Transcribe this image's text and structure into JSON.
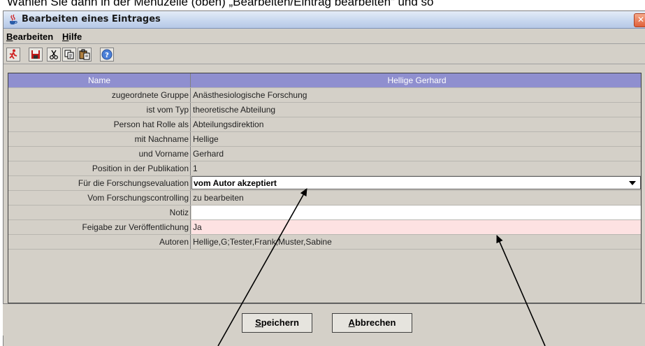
{
  "caption": "Wählen Sie dann in der Menüzeile (oben) „Bearbeiten/Eintrag bearbeiten“ und so",
  "window": {
    "title": "Bearbeiten eines Eintrages",
    "close_glyph": "✕"
  },
  "menu": [
    {
      "mnemonic": "B",
      "rest": "earbeiten"
    },
    {
      "mnemonic": "H",
      "rest": "ilfe"
    }
  ],
  "toolbar": {
    "icons": [
      "exit-icon",
      "save-icon",
      "cut-icon",
      "copy-icon",
      "paste-icon",
      "help-icon"
    ]
  },
  "table": {
    "header": {
      "label": "Name",
      "value": "Hellige Gerhard"
    },
    "rows": [
      {
        "label": "zugeordnete Gruppe",
        "value": "Anästhesiologische Forschung"
      },
      {
        "label": "ist vom Typ",
        "value": "theoretische Abteilung"
      },
      {
        "label": "Person hat Rolle als",
        "value": "Abteilungsdirektion"
      },
      {
        "label": "mit Nachname",
        "value": "Hellige"
      },
      {
        "label": "und Vorname",
        "value": "Gerhard"
      },
      {
        "label": "Position in der Publikation",
        "value": "1"
      },
      {
        "label": "Für die Forschungsevaluation",
        "value": "vom Autor akzeptiert"
      },
      {
        "label": "Vom Forschungscontrolling",
        "value": "zu bearbeiten"
      },
      {
        "label": "Notiz",
        "value": ""
      },
      {
        "label": "Feigabe zur Veröffentlichung",
        "value": "Ja"
      },
      {
        "label": "Autoren",
        "value": "Hellige,G;Tester,Frank;Muster,Sabine"
      }
    ]
  },
  "buttons": {
    "save": {
      "mnemonic": "S",
      "rest": "peichern"
    },
    "cancel": {
      "mnemonic": "A",
      "rest": "bbrechen"
    }
  },
  "colors": {
    "header_bg": "#8f8fcf",
    "pink_highlight": "#fde2e2",
    "window_bg": "#d4d0c8"
  }
}
